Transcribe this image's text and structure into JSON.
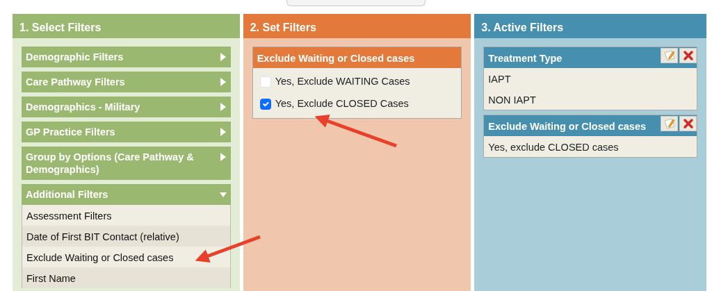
{
  "select_filters": {
    "title": "1. Select Filters",
    "groups": [
      {
        "label": "Demographic Filters",
        "expanded": false
      },
      {
        "label": "Care Pathway Filters",
        "expanded": false
      },
      {
        "label": "Demographics - Military",
        "expanded": false
      },
      {
        "label": "GP Practice Filters",
        "expanded": false
      },
      {
        "label": "Group by Options (Care Pathway & Demographics)",
        "expanded": false
      },
      {
        "label": "Additional Filters",
        "expanded": true,
        "children": [
          {
            "label": "Assessment Filters"
          },
          {
            "label": "Date of First BIT Contact (relative)"
          },
          {
            "label": "Exclude Waiting or Closed cases"
          },
          {
            "label": "First Name"
          }
        ]
      }
    ]
  },
  "set_filters": {
    "title": "2. Set Filters",
    "card": {
      "title": "Exclude Waiting or Closed cases",
      "options": [
        {
          "label": "Yes, Exclude WAITING Cases",
          "checked": false
        },
        {
          "label": "Yes, Exclude CLOSED Cases",
          "checked": true
        }
      ]
    }
  },
  "active_filters": {
    "title": "3. Active Filters",
    "cards": [
      {
        "title": "Treatment Type",
        "values": [
          "IAPT",
          "NON IAPT"
        ]
      },
      {
        "title": "Exclude Waiting or Closed cases",
        "values": [
          "Yes, exclude CLOSED cases"
        ]
      }
    ]
  }
}
